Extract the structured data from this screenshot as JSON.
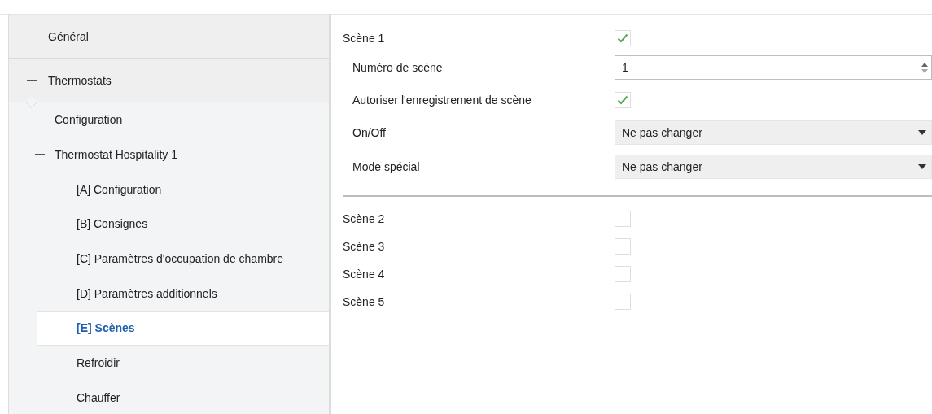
{
  "sidebar": {
    "items": [
      {
        "label": "Général",
        "selected": false
      },
      {
        "label": "Thermostats",
        "selected": false,
        "expanded": true,
        "children": [
          {
            "label": "Configuration",
            "selected": false
          },
          {
            "label": "Thermostat Hospitality 1",
            "selected": false,
            "expanded": true,
            "children": [
              {
                "label": "[A] Configuration",
                "selected": false
              },
              {
                "label": "[B] Consignes",
                "selected": false
              },
              {
                "label": "[C] Paramètres d'occupation de chambre",
                "selected": false
              },
              {
                "label": "[D] Paramètres additionnels",
                "selected": false
              },
              {
                "label": "[E] Scènes",
                "selected": true
              },
              {
                "label": "Refroidir",
                "selected": false
              },
              {
                "label": "Chauffer",
                "selected": false
              }
            ]
          }
        ]
      }
    ]
  },
  "scenes": [
    {
      "label": "Scène 1",
      "checked": true,
      "children": [
        {
          "kind": "number",
          "label": "Numéro de scène",
          "value": "1"
        },
        {
          "kind": "checkbox",
          "label": "Autoriser l'enregistrement de scène",
          "checked": true
        },
        {
          "kind": "dropdown",
          "label": "On/Off",
          "value": "Ne pas changer"
        },
        {
          "kind": "dropdown",
          "label": "Mode spécial",
          "value": "Ne pas changer"
        }
      ]
    },
    {
      "label": "Scène 2",
      "checked": false
    },
    {
      "label": "Scène 3",
      "checked": false
    },
    {
      "label": "Scène 4",
      "checked": false
    },
    {
      "label": "Scène 5",
      "checked": false
    }
  ]
}
